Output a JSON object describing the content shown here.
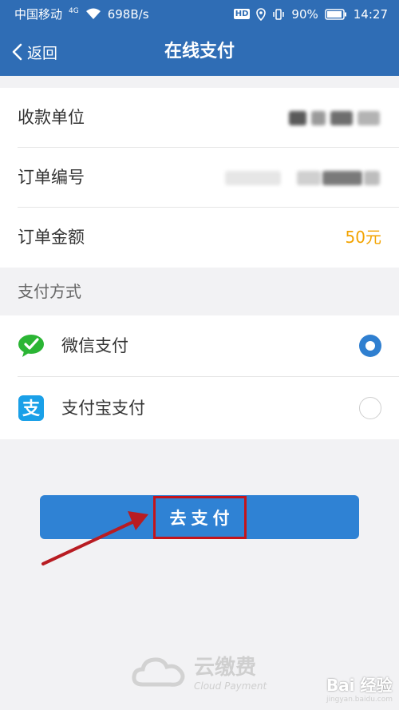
{
  "status_bar": {
    "carrier": "中国移动",
    "network": "4G",
    "speed": "698B/s",
    "hd": "HD",
    "battery": "90%",
    "time": "14:27"
  },
  "nav": {
    "back_label": "返回",
    "title": "在线支付"
  },
  "order": {
    "payee_label": "收款单位",
    "order_no_label": "订单编号",
    "amount_label": "订单金额",
    "amount_value": "50元"
  },
  "payment": {
    "section_label": "支付方式",
    "methods": [
      {
        "label": "微信支付",
        "icon": "wechat-pay-icon",
        "selected": true
      },
      {
        "label": "支付宝支付",
        "icon": "alipay-icon",
        "selected": false
      }
    ]
  },
  "pay_button_label": "去支付",
  "footer": {
    "brand": "云缴费",
    "brand_en": "Cloud Payment"
  },
  "watermark": {
    "text": "Bai 经验",
    "url": "jingyan.baidu.com"
  },
  "colors": {
    "header": "#2f6db5",
    "accent": "#2f82d4",
    "amount": "#f3a300",
    "highlight_box": "#c4141b"
  }
}
